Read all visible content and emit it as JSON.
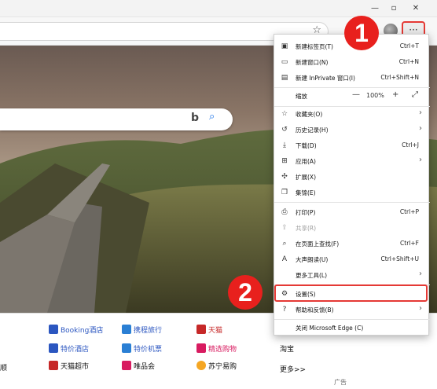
{
  "window": {
    "minimize": "—",
    "maximize": "▫",
    "close": "✕"
  },
  "toolbar": {
    "more_label": "···",
    "favorite_icon": "star-icon"
  },
  "search": {
    "bing_label": "b",
    "search_icon": "magnifier-icon"
  },
  "links": {
    "row1": [
      {
        "label": "Booking酒店",
        "color": "#2b56c0",
        "icon": "#2b56c0"
      },
      {
        "label": "携程旅行",
        "color": "#2b56c0",
        "icon": "#2a7fd4"
      },
      {
        "label": "天猫",
        "color": "#c62828",
        "icon": "#c62828"
      }
    ],
    "row2": [
      {
        "label": "特价酒店",
        "color": "#2b56c0",
        "icon": "#2b56c0"
      },
      {
        "label": "特价机票",
        "color": "#2b56c0",
        "icon": "#2a7fd4"
      },
      {
        "label": "精选购物",
        "color": "#d81b60",
        "icon": "#d81b60"
      },
      {
        "label": "淘宝",
        "color": "#222",
        "icon": "#ff6a00"
      }
    ],
    "row3": [
      {
        "label": "天猫超市",
        "color": "#222",
        "icon": "#c62828"
      },
      {
        "label": "唯品会",
        "color": "#222",
        "icon": "#d81b60"
      },
      {
        "label": "苏宁易购",
        "color": "#222",
        "icon": "#f5a623"
      },
      {
        "label": "更多>>",
        "color": "#222",
        "icon": ""
      }
    ],
    "left_partial": [
      "",
      "",
      "顺"
    ],
    "ad": "广告"
  },
  "menu": {
    "items": [
      {
        "label": "新建标签页(T)",
        "shortcut": "Ctrl+T",
        "icon": "new-tab-icon",
        "glyph": "▣"
      },
      {
        "label": "新建窗口(N)",
        "shortcut": "Ctrl+N",
        "icon": "new-window-icon",
        "glyph": "▭"
      },
      {
        "label": "新建 InPrivate 窗口(I)",
        "shortcut": "Ctrl+Shift+N",
        "icon": "inprivate-icon",
        "glyph": "▤"
      },
      {
        "label": "收藏夹(O)",
        "icon": "favorites-icon",
        "glyph": "☆",
        "arrow": true
      },
      {
        "label": "历史记录(H)",
        "icon": "history-icon",
        "glyph": "↺",
        "arrow": true
      },
      {
        "label": "下载(D)",
        "shortcut": "Ctrl+J",
        "icon": "download-icon",
        "glyph": "⤓"
      },
      {
        "label": "应用(A)",
        "icon": "apps-icon",
        "glyph": "⊞",
        "arrow": true
      },
      {
        "label": "扩展(X)",
        "icon": "extensions-icon",
        "glyph": "✣"
      },
      {
        "label": "集锦(E)",
        "icon": "collections-icon",
        "glyph": "❐"
      },
      {
        "label": "打印(P)",
        "shortcut": "Ctrl+P",
        "icon": "print-icon",
        "glyph": "⎙"
      },
      {
        "label": "共享(R)",
        "icon": "share-icon",
        "glyph": "⇪",
        "disabled": true
      },
      {
        "label": "在页面上查找(F)",
        "shortcut": "Ctrl+F",
        "icon": "find-icon",
        "glyph": "⌕"
      },
      {
        "label": "大声朗读(U)",
        "shortcut": "Ctrl+Shift+U",
        "icon": "read-aloud-icon",
        "glyph": "A"
      },
      {
        "label": "更多工具(L)",
        "icon": "",
        "glyph": "",
        "arrow": true
      },
      {
        "label": "设置(S)",
        "icon": "settings-icon",
        "glyph": "⚙"
      },
      {
        "label": "帮助和反馈(B)",
        "icon": "help-icon",
        "glyph": "?",
        "arrow": true
      },
      {
        "label": "关闭 Microsoft Edge (C)",
        "icon": "",
        "glyph": ""
      }
    ],
    "zoom": {
      "label": "缩放",
      "value": "100%",
      "minus": "—",
      "plus": "+",
      "fullscreen": "⤢"
    }
  },
  "annotations": {
    "badge1": "1",
    "badge2": "2"
  },
  "colors": {
    "highlight": "#e53935",
    "badge": "#e8201d"
  }
}
